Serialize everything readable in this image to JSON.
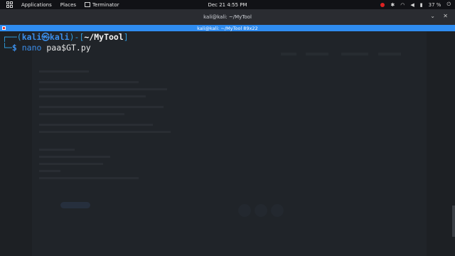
{
  "topbar": {
    "applications": "Applications",
    "places": "Places",
    "app_name": "Terminator",
    "clock": "Dec 21  4:55 PM",
    "battery": "37 %",
    "icons": [
      "show-apps-icon",
      "record-indicator-icon",
      "bluetooth-icon",
      "wifi-icon",
      "volume-icon",
      "battery-icon",
      "power-menu-icon"
    ]
  },
  "window": {
    "title": "kali@kali: ~/MyTool",
    "inner_title": "kali@kali: ~/MyTool 89x22"
  },
  "terminal": {
    "prompt_open": "┌──(",
    "user": "kali",
    "at": "㉿",
    "host": "kali",
    "sep": ")-[",
    "path": "~/MyTool",
    "close": "]",
    "line2_prefix": "└─",
    "dollar": "$",
    "command": "nano",
    "argument": "paa$GT.py"
  },
  "colors": {
    "accent": "#2f8cf0",
    "prompt_blue": "#3b8eea",
    "terminal_bg": "#1d2024",
    "panel_bg": "#111216"
  }
}
